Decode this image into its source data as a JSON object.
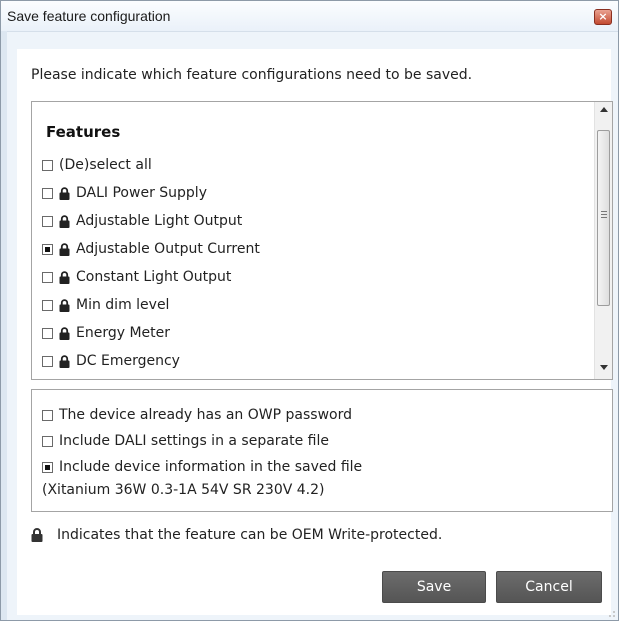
{
  "window": {
    "title": "Save feature configuration",
    "close_glyph": "×"
  },
  "intro": "Please indicate which feature configurations need to be saved.",
  "features": {
    "heading": "Features",
    "items": [
      {
        "label": "(De)select all",
        "checked": false,
        "locked": false
      },
      {
        "label": "DALI Power Supply",
        "checked": false,
        "locked": true
      },
      {
        "label": "Adjustable Light Output",
        "checked": false,
        "locked": true
      },
      {
        "label": "Adjustable Output Current",
        "checked": true,
        "locked": true
      },
      {
        "label": "Constant Light Output",
        "checked": false,
        "locked": true
      },
      {
        "label": "Min dim level",
        "checked": false,
        "locked": true
      },
      {
        "label": "Energy Meter",
        "checked": false,
        "locked": true
      },
      {
        "label": "DC Emergency",
        "checked": false,
        "locked": true
      }
    ]
  },
  "options": {
    "items": [
      {
        "label": "The device already has an OWP password",
        "checked": false
      },
      {
        "label": "Include DALI settings in a separate file",
        "checked": false
      },
      {
        "label": "Include device information in the saved file",
        "checked": true
      }
    ],
    "device_info": "(Xitanium 36W 0.3-1A 54V SR 230V 4.2)"
  },
  "legend": {
    "text": "Indicates that the feature can be OEM Write-protected.",
    "icon": "lock-icon"
  },
  "buttons": {
    "save": "Save",
    "cancel": "Cancel"
  },
  "colors": {
    "button_bg": "#5e5e5e",
    "close_bg": "#c94b32"
  }
}
